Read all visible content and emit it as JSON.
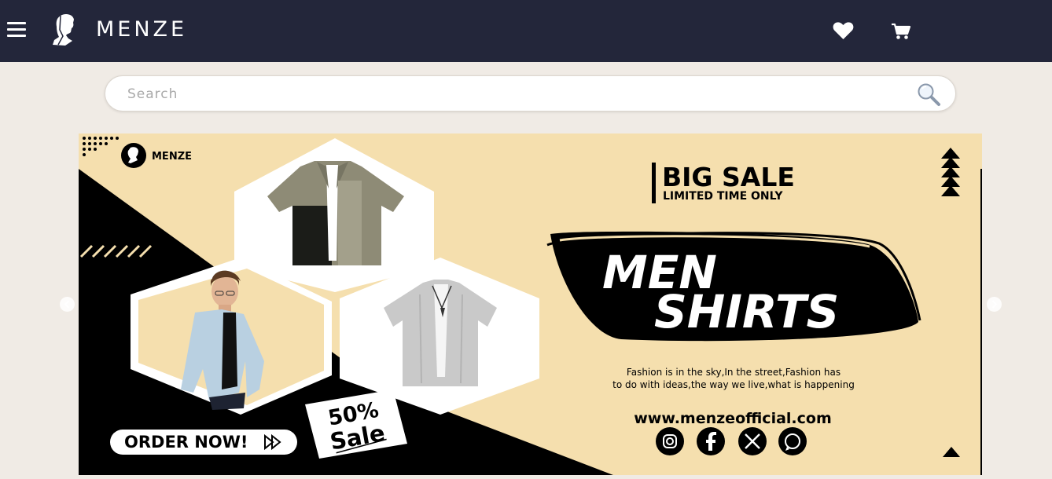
{
  "header": {
    "brand": "MENZE",
    "icons": [
      "menu-icon",
      "menze-logo-icon",
      "heart-icon",
      "cart-icon"
    ]
  },
  "search": {
    "placeholder": "Search",
    "value": "",
    "icon": "magnifier-icon"
  },
  "banner": {
    "logo_text": "MENZE",
    "headline": "BIG SALE",
    "subheadline": "LIMITED TIME ONLY",
    "title_line1": "MEN",
    "title_line2": "SHIRTS",
    "tagline_line1": "Fashion is in the sky,In the street,Fashion has",
    "tagline_line2": "to do with ideas,the way we live,what is happening",
    "website": "www.menzeofficial.com",
    "sale_line1": "50%",
    "sale_line2": "Sale",
    "order_button": "ORDER NOW!",
    "social_icons": [
      "instagram-icon",
      "facebook-icon",
      "x-icon",
      "whatsapp-icon"
    ],
    "colors": {
      "cream": "#f5dfae",
      "black": "#000000",
      "white": "#ffffff"
    }
  },
  "carousel": {
    "prev_icon": "chevron-left-icon",
    "next_icon": "chevron-right-icon"
  },
  "colors": {
    "navbar": "#23263a",
    "page_bg": "#f0ebe5"
  }
}
